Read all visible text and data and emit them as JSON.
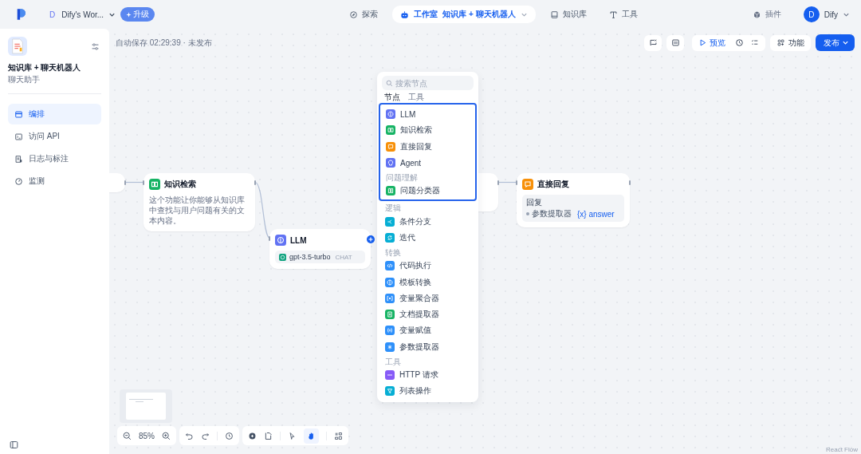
{
  "topbar": {
    "workspace": {
      "avatar": "D",
      "name": "Dify's Wor...",
      "upgrade": "升级"
    },
    "nav": [
      {
        "label": "探索",
        "selected": false,
        "kind": "explore"
      },
      {
        "label": "工作室",
        "selected": true,
        "kind": "studio",
        "app_name": "知识库 + 聊天机器人"
      },
      {
        "label": "知识库",
        "selected": false,
        "kind": "knowledge"
      },
      {
        "label": "工具",
        "selected": false,
        "kind": "tools"
      }
    ],
    "plugins": "插件",
    "user": {
      "avatar": "D",
      "name": "Dify"
    }
  },
  "sidebar": {
    "app_title": "知识库 + 聊天机器人",
    "app_subtitle": "聊天助手",
    "items": [
      {
        "label": "编排",
        "selected": true,
        "kind": "layout"
      },
      {
        "label": "访问 API",
        "selected": false,
        "kind": "terminal"
      },
      {
        "label": "日志与标注",
        "selected": false,
        "kind": "log"
      },
      {
        "label": "监测",
        "selected": false,
        "kind": "monitor"
      }
    ]
  },
  "canvas": {
    "status": "自动保存 02:29:39 · 未发布",
    "preview": "预览",
    "features": "功能",
    "publish": "发布",
    "zoom": "85%",
    "attribution": "React Flow",
    "nodes": [
      {
        "kind": "partial"
      },
      {
        "kind": "knowledge",
        "title": "知识检索",
        "color": "#16b364",
        "description": "这个功能让你能够从知识库中查找与用户问题有关的文本内容。"
      },
      {
        "kind": "llm",
        "title": "LLM",
        "color": "#6172f3",
        "model": "gpt-3.5-turbo",
        "tag": "CHAT"
      },
      {
        "kind": "partial"
      },
      {
        "kind": "answer",
        "title": "直接回复",
        "color": "#f79009",
        "label": "回复",
        "source": "参数提取器",
        "variable": "{x} answer"
      }
    ]
  },
  "menu": {
    "placeholder": "搜索节点",
    "tabs": [
      {
        "label": "节点",
        "selected": true
      },
      {
        "label": "工具",
        "selected": false
      }
    ],
    "blocks": [
      {
        "highlighted": true,
        "sections": [
          {
            "items": [
              {
                "label": "LLM",
                "kind": "llm",
                "color": "#6172f3"
              },
              {
                "label": "知识检索",
                "kind": "knowledge",
                "color": "#16b364"
              },
              {
                "label": "直接回复",
                "kind": "answer",
                "color": "#f79009"
              },
              {
                "label": "Agent",
                "kind": "agent",
                "color": "#6172f3"
              }
            ]
          },
          {
            "heading": "问题理解",
            "items": [
              {
                "label": "问题分类器",
                "kind": "classifier",
                "color": "#16b364"
              }
            ]
          }
        ]
      },
      {
        "highlighted": false,
        "sections": [
          {
            "heading": "逻辑",
            "items": [
              {
                "label": "条件分支",
                "kind": "branch",
                "color": "#06aed4"
              },
              {
                "label": "迭代",
                "kind": "loop",
                "color": "#06aed4"
              }
            ]
          },
          {
            "heading": "转换",
            "items": [
              {
                "label": "代码执行",
                "kind": "code",
                "color": "#2e90fa"
              },
              {
                "label": "模板转换",
                "kind": "template",
                "color": "#2e90fa"
              },
              {
                "label": "变量聚合器",
                "kind": "aggregator",
                "color": "#2e90fa"
              },
              {
                "label": "文档提取器",
                "kind": "document",
                "color": "#16b364"
              },
              {
                "label": "变量赋值",
                "kind": "assigner",
                "color": "#2e90fa"
              },
              {
                "label": "参数提取器",
                "kind": "parameter",
                "color": "#2e90fa"
              }
            ]
          },
          {
            "heading": "工具",
            "items": [
              {
                "label": "HTTP 请求",
                "kind": "http",
                "color": "#875bf7"
              },
              {
                "label": "列表操作",
                "kind": "list",
                "color": "#06aed4"
              }
            ]
          }
        ]
      }
    ]
  }
}
